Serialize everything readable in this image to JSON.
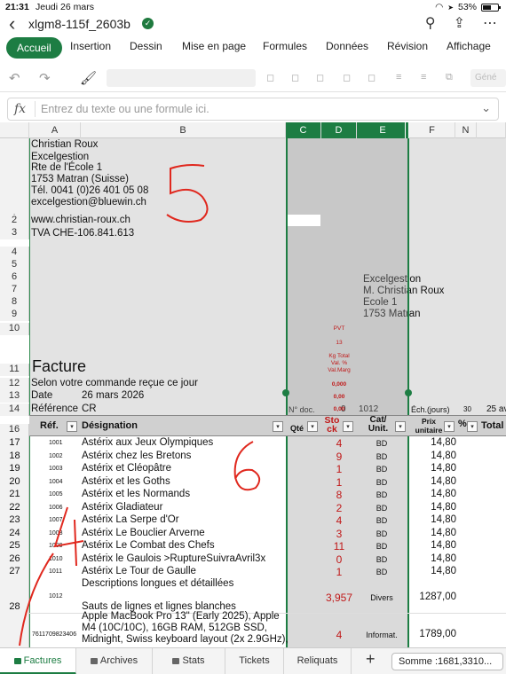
{
  "status_bar": {
    "time": "21:31",
    "date": "Jeudi 26 mars",
    "battery": "53%"
  },
  "title_bar": {
    "doc_title": "xlgm8-115f_2603b"
  },
  "ribbon": {
    "tabs": [
      "Accueil",
      "Insertion",
      "Dessin",
      "Mise en page",
      "Formules",
      "Données",
      "Révision",
      "Affichage"
    ],
    "active": "Accueil"
  },
  "toolbar": {
    "format_label": "Géné"
  },
  "formula_bar": {
    "placeholder": "Entrez du texte ou une formule ici."
  },
  "columns": [
    "A",
    "B",
    "C",
    "D",
    "E",
    "F",
    "N"
  ],
  "address": {
    "name": "Christian Roux",
    "company": "Excelgestion",
    "street": "Rte de l'École 1",
    "city": "1753 Matran (Suisse)",
    "phone": "Tél. 0041 (0)26 401 05 08",
    "email": "excelgestion@bluewin.ch",
    "web": "www.christian-roux.ch",
    "tva": "TVA CHE-106.841.613"
  },
  "recipient": {
    "line1": "Excelgestion",
    "line2": "M. Christian Roux",
    "line3": "Ecole 1",
    "line4": "1753 Matran"
  },
  "invoice": {
    "title": "Facture",
    "line12": "Selon votre commande reçue ce jour",
    "date_label": "Date",
    "date_value": "26 mars 2026",
    "ref_label": "Référence",
    "ref_value": "CR",
    "doc_label": "N° doc.",
    "doc_zero": "0",
    "doc_value": "1012",
    "echeance_label": "Éch.(jours)",
    "echeance_value": "30",
    "echeance_date": "25 av"
  },
  "pvt_block": {
    "pvt": "PVT",
    "pvt_val": "13",
    "kg_total": "Kg Total",
    "val_pct": "Val. %",
    "val_marg": "Val.Marg",
    "v1": "0,000",
    "v2": "0,00",
    "v3": "0,00"
  },
  "table_header": {
    "ref": "Réf.",
    "designation": "Désignation",
    "qte": "Qté",
    "stock": "Sto ck",
    "cat": "Cat/ Unit.",
    "prix": "Prix unitaire",
    "pct": "%",
    "total": "Total"
  },
  "rows": [
    {
      "row": "17",
      "ref": "1001",
      "designation": "Astérix aux Jeux Olympiques",
      "stock": "4",
      "unit": "BD",
      "price": "14,80"
    },
    {
      "row": "18",
      "ref": "1002",
      "designation": "Astérix chez les Bretons",
      "stock": "9",
      "unit": "BD",
      "price": "14,80"
    },
    {
      "row": "19",
      "ref": "1003",
      "designation": "Astérix et Cléopâtre",
      "stock": "1",
      "unit": "BD",
      "price": "14,80"
    },
    {
      "row": "20",
      "ref": "1004",
      "designation": "Astérix et les Goths",
      "stock": "1",
      "unit": "BD",
      "price": "14,80"
    },
    {
      "row": "21",
      "ref": "1005",
      "designation": "Astérix et les Normands",
      "stock": "8",
      "unit": "BD",
      "price": "14,80"
    },
    {
      "row": "22",
      "ref": "1006",
      "designation": "Astérix Gladiateur",
      "stock": "2",
      "unit": "BD",
      "price": "14,80"
    },
    {
      "row": "23",
      "ref": "1007",
      "designation": "Astérix La Serpe d'Or",
      "stock": "4",
      "unit": "BD",
      "price": "14,80"
    },
    {
      "row": "24",
      "ref": "1008",
      "designation": "Astérix Le Bouclier Arverne",
      "stock": "3",
      "unit": "BD",
      "price": "14,80"
    },
    {
      "row": "25",
      "ref": "1009",
      "designation": "Astérix Le Combat des Chefs",
      "stock": "11",
      "unit": "BD",
      "price": "14,80"
    },
    {
      "row": "26",
      "ref": "1010",
      "designation": "Astérix le Gaulois >RuptureSuivraAvril3x",
      "stock": "0",
      "unit": "BD",
      "price": "14,80"
    },
    {
      "row": "27",
      "ref": "1011",
      "designation": "Astérix Le Tour de Gaulle",
      "stock": "1",
      "unit": "BD",
      "price": "14,80"
    }
  ],
  "row28": {
    "row": "28",
    "ref": "1012",
    "line1": "Descriptions longues et détaillées",
    "line2": "Sauts de lignes et lignes blanches",
    "stock": "3,957",
    "unit": "Divers",
    "price": "1287,00"
  },
  "row29": {
    "ref": "7611709823406",
    "line1": "Apple MacBook Pro 13\" (Early 2025), Apple",
    "line2": "M4 (10C/10C), 16GB RAM, 512GB SSD,",
    "line3": "Midnight, Swiss keyboard layout (2x 2.9GHz),",
    "stock": "4",
    "unit": "Informat.",
    "price": "1789,00"
  },
  "handwriting": {
    "a": "5",
    "b": "6",
    "c": "4"
  },
  "sheet_tabs": [
    "Factures",
    "Archives",
    "Stats",
    "Tickets",
    "Reliquats"
  ],
  "active_sheet": "Factures",
  "sum_label": "Somme :1681,3310..."
}
